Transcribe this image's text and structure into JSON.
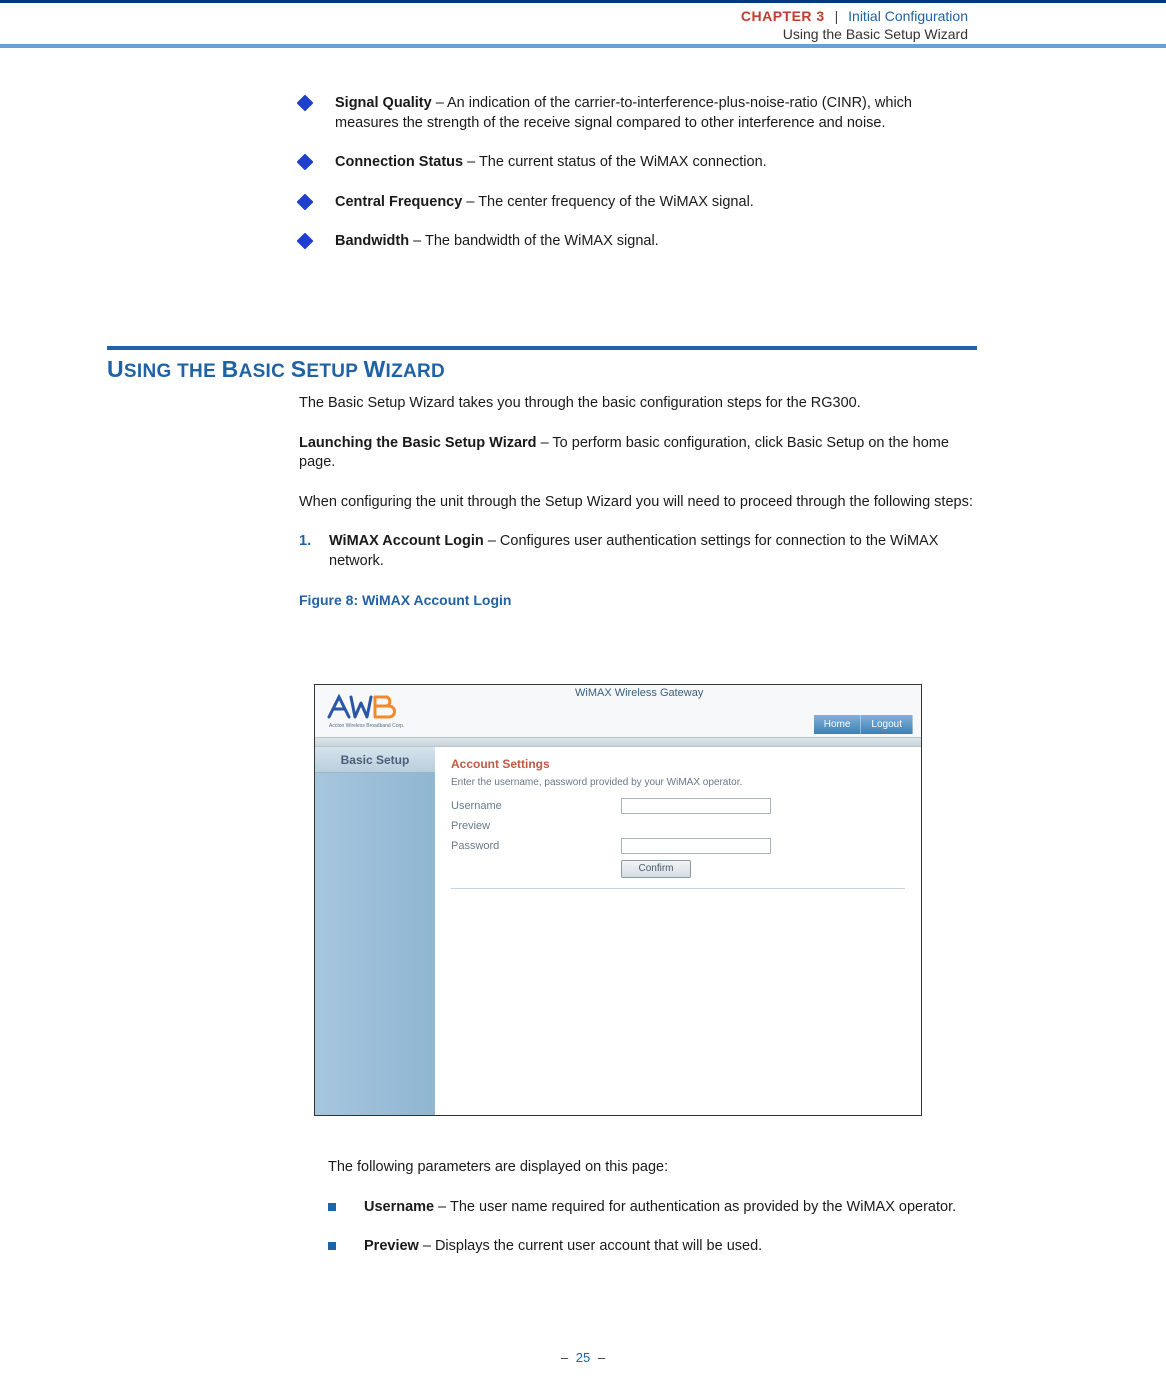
{
  "header": {
    "chapter": "CHAPTER 3",
    "separator": "|",
    "line1": "Initial Configuration",
    "line2": "Using the Basic Setup Wizard"
  },
  "bullets_top": [
    {
      "term": "Signal Quality",
      "desc": " – An indication of the carrier-to-interference-plus-noise-ratio (CINR), which measures the strength of the receive signal compared to other interference and noise."
    },
    {
      "term": "Connection Status",
      "desc": " – The current status of the WiMAX connection."
    },
    {
      "term": "Central Frequency",
      "desc": " – The center frequency of the WiMAX signal."
    },
    {
      "term": "Bandwidth",
      "desc": " – The bandwidth of the WiMAX signal."
    }
  ],
  "section_title": "Using the Basic Setup Wizard",
  "body": {
    "intro": "The Basic Setup Wizard takes you through the basic configuration steps for the RG300.",
    "launch_term": "Launching the Basic Setup Wizard",
    "launch_desc": " – To perform basic configuration, click Basic Setup on the home page.",
    "steps_intro": "When configuring the unit through the Setup Wizard you will need to proceed through the following steps:",
    "step1_num": "1.",
    "step1_term": "WiMAX Account Login",
    "step1_desc": " – Configures user authentication settings for connection to the WiMAX network.",
    "figure_caption": "Figure 8:  WiMAX Account Login"
  },
  "screenshot": {
    "product_title": "WiMAX Wireless Gateway",
    "logo_sub": "Accton Wireless Broadband Corp.",
    "btn_home": "Home",
    "btn_logout": "Logout",
    "side_tab": "Basic Setup",
    "panel_title": "Account Settings",
    "panel_help": "Enter the username, password provided by your WiMAX operator.",
    "lbl_username": "Username",
    "lbl_preview": "Preview",
    "lbl_password": "Password",
    "btn_confirm": "Confirm"
  },
  "after_figure": {
    "intro": "The following parameters are displayed on this page:",
    "items": [
      {
        "term": "Username",
        "desc": " – The user name required for authentication as provided by the WiMAX operator."
      },
      {
        "term": "Preview",
        "desc": " – Displays the current user account that will be used."
      }
    ]
  },
  "footer": {
    "dash": "–",
    "page": "25"
  }
}
